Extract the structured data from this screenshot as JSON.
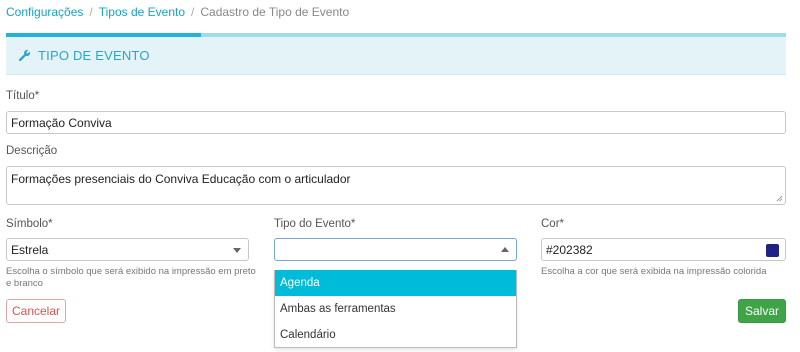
{
  "breadcrumb": {
    "items": [
      "Configurações",
      "Tipos de Evento"
    ],
    "separator": "/",
    "current": "Cadastro de Tipo de Evento"
  },
  "progress": {
    "value_percent": 25
  },
  "panel": {
    "title": "TIPO DE EVENTO",
    "icon": "wrench-icon"
  },
  "form": {
    "titulo": {
      "label": "Título*",
      "value": "Formação Conviva"
    },
    "descricao": {
      "label": "Descrição",
      "value": "Formações presenciais do Conviva Educação com o articulador"
    },
    "simbolo": {
      "label": "Símbolo*",
      "value": "Estrela",
      "help": "Escolha o símbolo que será exibido na impressão em preto e branco"
    },
    "tipo": {
      "label": "Tipo do Evento*",
      "value": "",
      "options": [
        "Agenda",
        "Ambas as ferramentas",
        "Calendário"
      ],
      "highlighted": "Agenda"
    },
    "cor": {
      "label": "Cor*",
      "value": "#202382",
      "swatch_color": "#202382",
      "help": "Escolha a cor que será exibida na impressão colorida"
    }
  },
  "buttons": {
    "cancel": "Cancelar",
    "save": "Salvar"
  },
  "colors": {
    "accent": "#21b4d6",
    "danger": "#d9534f",
    "success": "#3ea447",
    "highlight": "#00bcd8"
  }
}
